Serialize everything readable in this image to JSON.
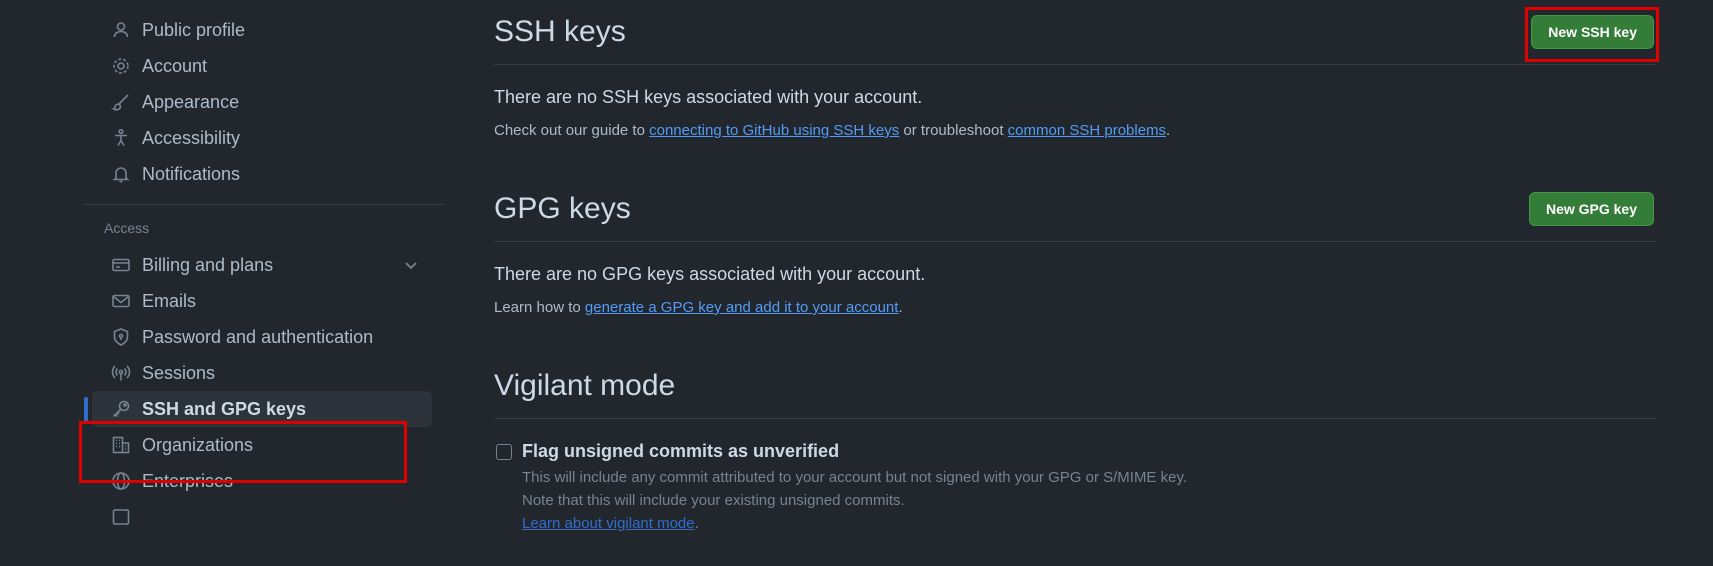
{
  "sidebar": {
    "items_top": [
      {
        "label": "Public profile",
        "icon": "person-icon"
      },
      {
        "label": "Account",
        "icon": "gear-icon"
      },
      {
        "label": "Appearance",
        "icon": "paintbrush-icon"
      },
      {
        "label": "Accessibility",
        "icon": "accessibility-icon"
      },
      {
        "label": "Notifications",
        "icon": "bell-icon"
      }
    ],
    "section_access": "Access",
    "items_access": [
      {
        "label": "Billing and plans",
        "icon": "credit-card-icon"
      },
      {
        "label": "Emails",
        "icon": "mail-icon"
      },
      {
        "label": "Password and authentication",
        "icon": "shield-icon"
      },
      {
        "label": "Sessions",
        "icon": "broadcast-icon"
      },
      {
        "label": "SSH and GPG keys",
        "icon": "key-icon",
        "active": true
      },
      {
        "label": "Organizations",
        "icon": "organization-icon"
      },
      {
        "label": "Enterprises",
        "icon": "globe-icon"
      }
    ]
  },
  "ssh": {
    "title": "SSH keys",
    "button": "New SSH key",
    "empty": "There are no SSH keys associated with your account.",
    "guide_prefix": "Check out our guide to ",
    "guide_link": "connecting to GitHub using SSH keys",
    "guide_mid": " or troubleshoot ",
    "guide_link2": "common SSH problems",
    "guide_suffix": "."
  },
  "gpg": {
    "title": "GPG keys",
    "button": "New GPG key",
    "empty": "There are no GPG keys associated with your account.",
    "learn_prefix": "Learn how to ",
    "learn_link": "generate a GPG key and add it to your account",
    "learn_suffix": "."
  },
  "vigilant": {
    "title": "Vigilant mode",
    "checkbox_label": "Flag unsigned commits as unverified",
    "desc1": "This will include any commit attributed to your account but not signed with your GPG or S/MIME key.",
    "desc2": "Note that this will include your existing unsigned commits.",
    "learn_link": "Learn about vigilant mode",
    "learn_suffix": "."
  },
  "colors": {
    "background": "#22272e",
    "accent_link": "#539bf5",
    "button_green": "#347d39",
    "active_indicator": "#316dca",
    "highlight_red": "#e00000"
  }
}
